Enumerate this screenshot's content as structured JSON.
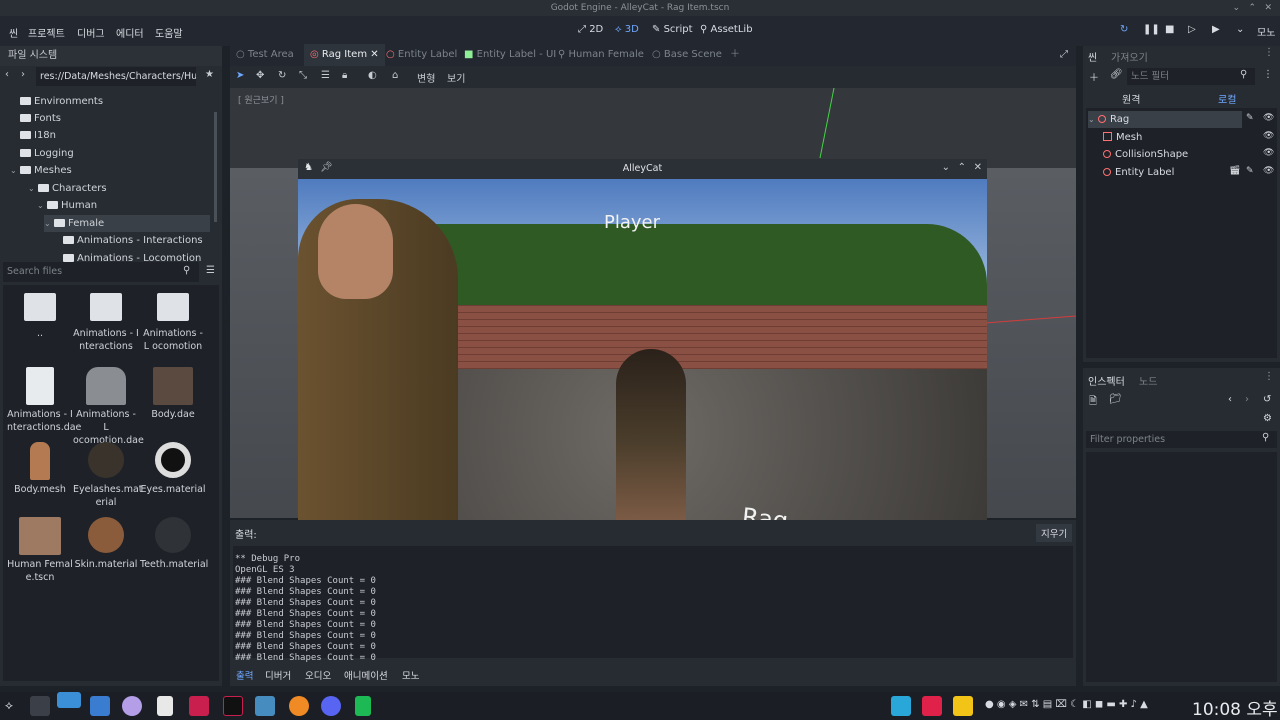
{
  "window": {
    "title": "Godot Engine - AlleyCat - Rag Item.tscn"
  },
  "menu": [
    "씬",
    "프로젝트",
    "디버그",
    "에디터",
    "도움말"
  ],
  "workspaces": [
    "2D",
    "3D",
    "Script",
    "AssetLib"
  ],
  "renderer": "모노",
  "filesystem": {
    "title": "파일 시스템",
    "path": "res://Data/Meshes/Characters/Hu",
    "tree": [
      "Environments",
      "Fonts",
      "I18n",
      "Logging",
      "Meshes",
      "Characters",
      "Human",
      "Female",
      "Animations - Interactions",
      "Animations - Locomotion"
    ],
    "search_placeholder": "Search files",
    "files": [
      {
        "label": ".."
      },
      {
        "label": "Animations - I nteractions"
      },
      {
        "label": "Animations - L ocomotion"
      },
      {
        "label": "Animations - I nteractions.dae"
      },
      {
        "label": "Animations - L ocomotion.dae"
      },
      {
        "label": "Body.dae"
      },
      {
        "label": "Body.mesh"
      },
      {
        "label": "Eyelashes.mat erial"
      },
      {
        "label": "Eyes.material"
      },
      {
        "label": "Human Femal e.tscn"
      },
      {
        "label": "Skin.material"
      },
      {
        "label": "Teeth.material"
      }
    ]
  },
  "tabs": [
    "Test Area",
    "Rag Item",
    "Entity Label",
    "Entity Label - UI",
    "Human Female",
    "Base Scene"
  ],
  "viewport_toolbar": {
    "transform": "변형",
    "view": "보기",
    "perspective": "[ 원근보기 ]"
  },
  "game_window": {
    "title": "AlleyCat",
    "label_player": "Player",
    "label_rag": "Rag"
  },
  "scene": {
    "tabs": [
      "씬",
      "가져오기"
    ],
    "filter_placeholder": "노드 필터",
    "mode": [
      "원격",
      "로컬"
    ],
    "nodes": [
      "Rag",
      "Mesh",
      "CollisionShape",
      "Entity Label"
    ]
  },
  "inspector": {
    "tabs": [
      "인스펙터",
      "노드"
    ],
    "filter_placeholder": "Filter properties"
  },
  "output": {
    "title": "출력:",
    "clear": "지우기",
    "lines": [
      "** Debug Pro",
      "OpenGL ES 3",
      "### Blend Shapes Count = 0",
      "### Blend Shapes Count = 0",
      "### Blend Shapes Count = 0",
      "### Blend Shapes Count = 0",
      "### Blend Shapes Count = 0",
      "### Blend Shapes Count = 0",
      "### Blend Shapes Count = 0",
      "### Blend Shapes Count = 0"
    ],
    "bottom_tabs": [
      "출력",
      "디버거",
      "오디오",
      "애니메이션",
      "모노"
    ]
  },
  "taskbar": {
    "clock": "10:08 오후"
  }
}
